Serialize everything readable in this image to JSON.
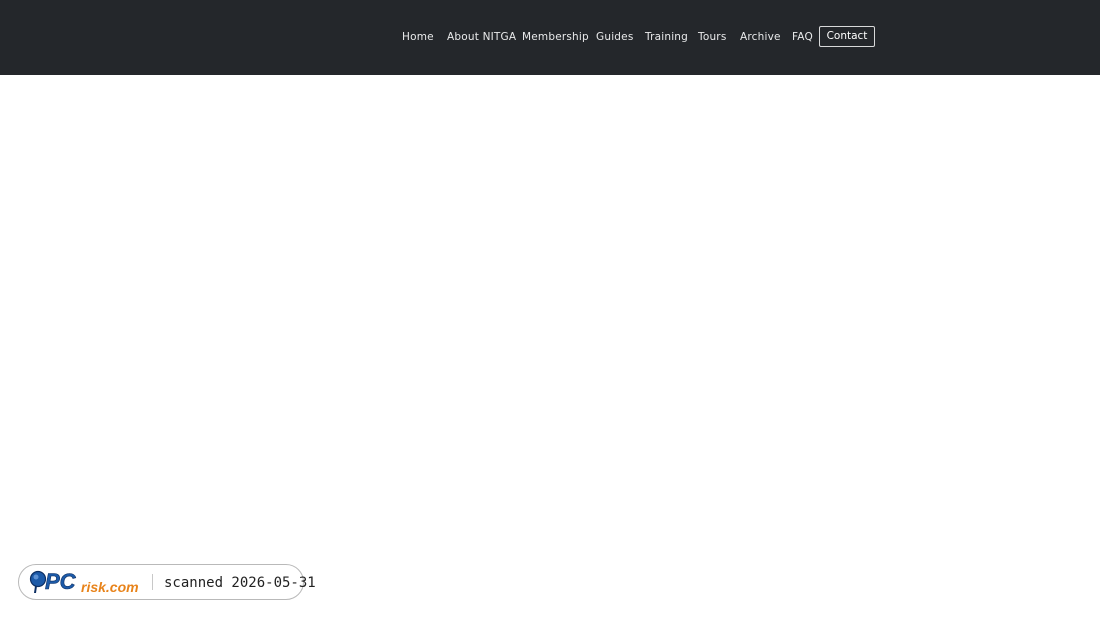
{
  "nav": {
    "items": [
      {
        "label": "Home"
      },
      {
        "label": "About NITGA"
      },
      {
        "label": "Membership"
      },
      {
        "label": "Guides"
      },
      {
        "label": "Training"
      },
      {
        "label": "Tours"
      },
      {
        "label": "Archive"
      },
      {
        "label": "FAQ"
      }
    ],
    "contact_label": "Contact"
  },
  "badge": {
    "logo_text": "PCrisk.com",
    "logo_text_pc": "PC",
    "logo_text_rest": "risk.com",
    "scan_text": "scanned 2026-05-31"
  },
  "colors": {
    "header_bg": "#24272b",
    "nav_text": "#e9eaeb",
    "logo_blue": "#1c5aa8",
    "logo_orange": "#e8831a"
  }
}
